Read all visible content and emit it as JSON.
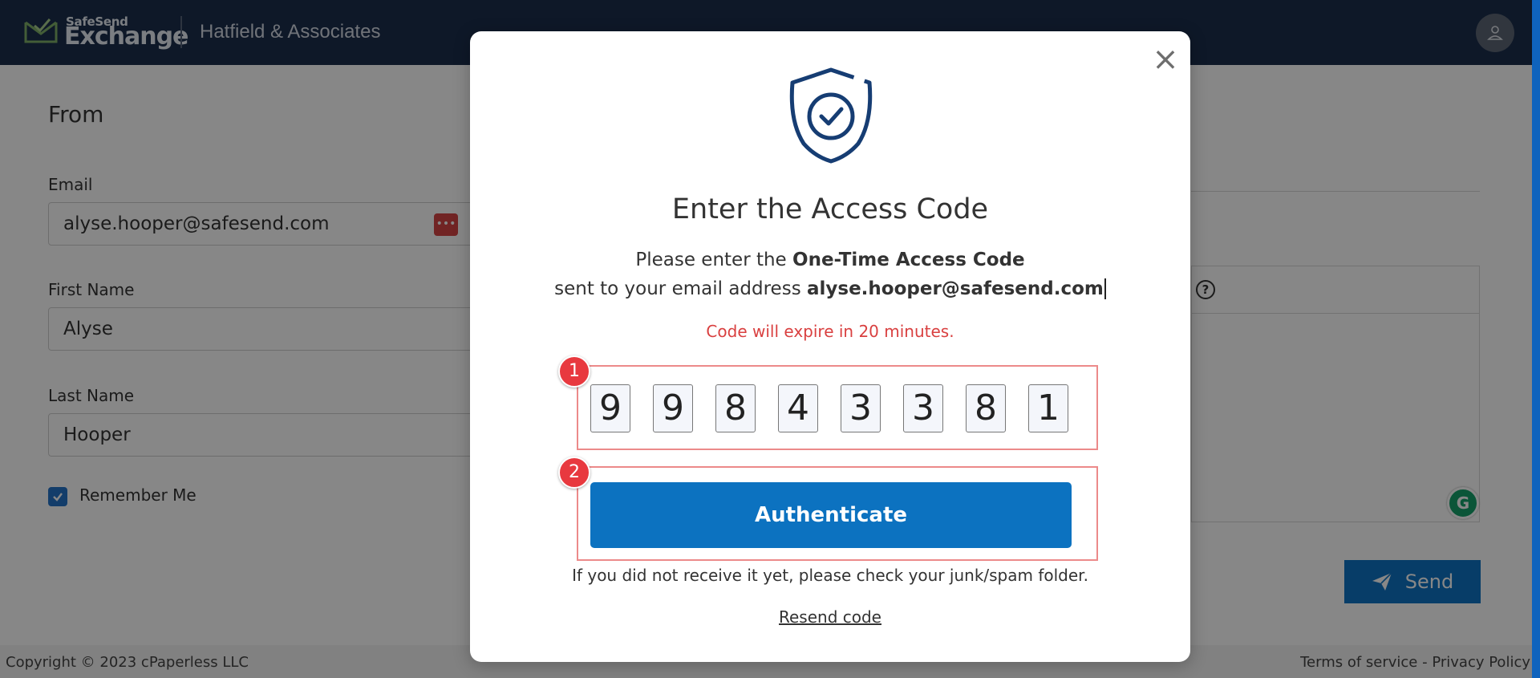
{
  "header": {
    "logo_small": "SafeSend",
    "logo_big": "Exchange",
    "firm_name": "Hatfield & Associates"
  },
  "form": {
    "section_title": "From",
    "email_label": "Email",
    "email_value": "alyse.hooper@safesend.com",
    "first_name_label": "First Name",
    "first_name_value": "Alyse",
    "last_name_label": "Last Name",
    "last_name_value": "Hooper",
    "remember_label": "Remember Me",
    "remember_checked": true
  },
  "compose": {
    "send_label": "Send",
    "help_glyph": "?",
    "grammarly_glyph": "G"
  },
  "footer": {
    "copyright": "Copyright © 2023 cPaperless LLC",
    "links": "Terms of service - Privacy Policy"
  },
  "modal": {
    "title": "Enter the Access Code",
    "line1_prefix": "Please enter the ",
    "line1_bold": "One-Time Access Code",
    "line2_prefix": "sent to your email address ",
    "line2_bold": "alyse.hooper@safesend.com",
    "expire_text": "Code will expire in 20 minutes.",
    "code_digits": [
      "9",
      "9",
      "8",
      "4",
      "3",
      "3",
      "8",
      "1"
    ],
    "authenticate_label": "Authenticate",
    "junk_note": "If you did not receive it yet, please check your junk/spam folder.",
    "resend_label": "Resend code",
    "close_glyph": "×"
  },
  "annotations": {
    "badge_1": "1",
    "badge_2": "2"
  },
  "colors": {
    "header_bg": "#1c2f4d",
    "primary_button": "#0c72c0",
    "expire_text": "#d94040",
    "annotation_red": "#e8393f",
    "shield": "#163d73"
  },
  "icons": {
    "logo": "envelope-check-icon",
    "avatar": "user-icon",
    "password_manager": "password-dots-icon",
    "checkbox": "checkmark-icon",
    "help": "question-circle-icon",
    "grammarly": "grammarly-icon",
    "send": "paper-plane-icon",
    "close": "close-icon",
    "shield": "shield-check-icon"
  }
}
